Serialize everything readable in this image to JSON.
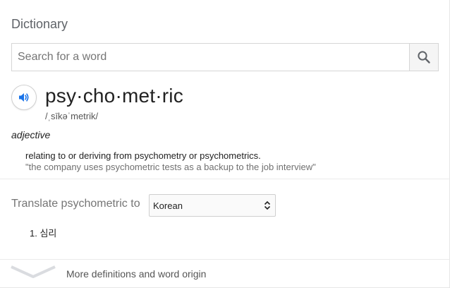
{
  "header": {
    "title": "Dictionary"
  },
  "search": {
    "placeholder": "Search for a word",
    "value": "",
    "button_icon": "search-icon"
  },
  "entry": {
    "headword": "psy·cho·met·ric",
    "phonetic": "/ˌsīkəˈmetrik/",
    "part_of_speech": "adjective",
    "definition": "relating to or deriving from psychometry or psychometrics.",
    "example": "\"the company uses psychometric tests as a backup to the job interview\"",
    "audio_icon": "speaker-icon"
  },
  "translate": {
    "label": "Translate psychometric to",
    "selected_language": "Korean",
    "results": [
      "심리"
    ]
  },
  "footer": {
    "more_label": "More definitions and word origin",
    "icon": "chevron-down-icon"
  },
  "colors": {
    "accent_blue": "#1a73e8",
    "muted_text": "#757575",
    "divider": "#ebebeb"
  }
}
